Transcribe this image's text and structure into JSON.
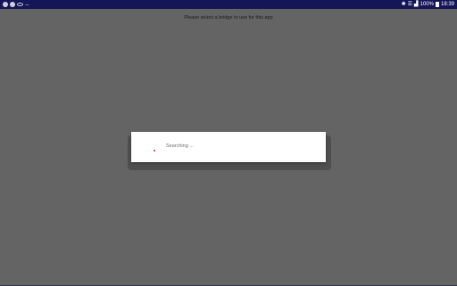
{
  "status_bar": {
    "left_icons": [
      "notification-circle-icon",
      "notification-circle-icon",
      "eye-icon"
    ],
    "overflow": "...",
    "bluetooth": "✱",
    "wifi": "☰",
    "signal": "▟",
    "battery_pct": "100%",
    "time": "18:39",
    "color": "#141658"
  },
  "main": {
    "prompt": "Please select a bridge to use for this app",
    "background": "#646464"
  },
  "dialog": {
    "message": "Searching ...",
    "spinner_color": "#d02020"
  }
}
